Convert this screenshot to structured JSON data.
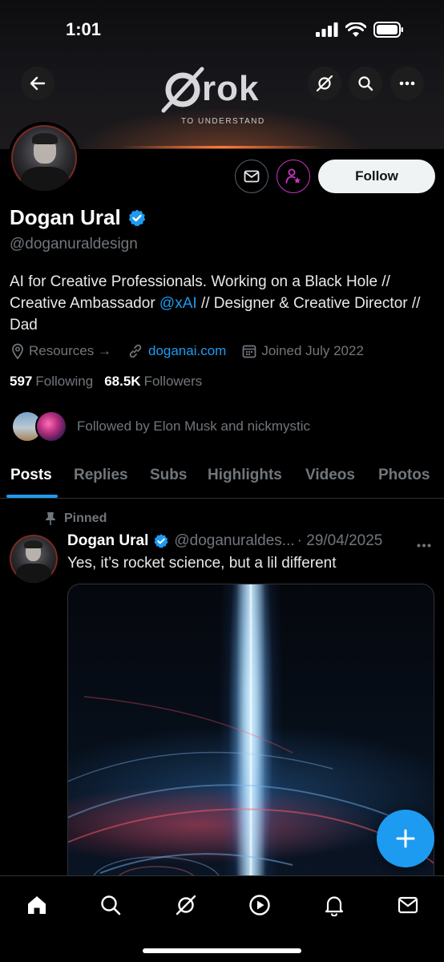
{
  "status_bar": {
    "time": "1:01"
  },
  "banner": {
    "logo_text": "rok",
    "tagline": "TO UNDERSTAND"
  },
  "profile": {
    "name": "Dogan Ural",
    "handle": "@doganuraldesign",
    "bio_part1": "AI for Creative Professionals. Working on a Black Hole // Creative Ambassador ",
    "bio_link": "@xAI",
    "bio_part2": " // Designer & Creative Director // Dad",
    "resources": "Resources →",
    "website": "doganai.com",
    "joined": "Joined July 2022",
    "following_count": "597",
    "following_label": "Following",
    "followers_count": "68.5K",
    "followers_label": "Followers",
    "followed_by": "Followed by Elon Musk and nickmystic",
    "follow_label": "Follow"
  },
  "tabs": [
    "Posts",
    "Replies",
    "Subs",
    "Highlights",
    "Videos",
    "Photos"
  ],
  "post": {
    "pinned_label": "Pinned",
    "author": "Dogan Ural",
    "handle": "@doganuraldes...",
    "date": "· 29/04/2025",
    "text": "Yes, it’s rocket science, but a lil different"
  },
  "colors": {
    "accent": "#1d9bf0",
    "subscribe": "#c936c5",
    "muted": "#71767b"
  },
  "icons": {
    "nav": [
      "home-icon",
      "search-icon",
      "grok-icon",
      "video-icon",
      "notifications-icon",
      "messages-icon"
    ]
  }
}
